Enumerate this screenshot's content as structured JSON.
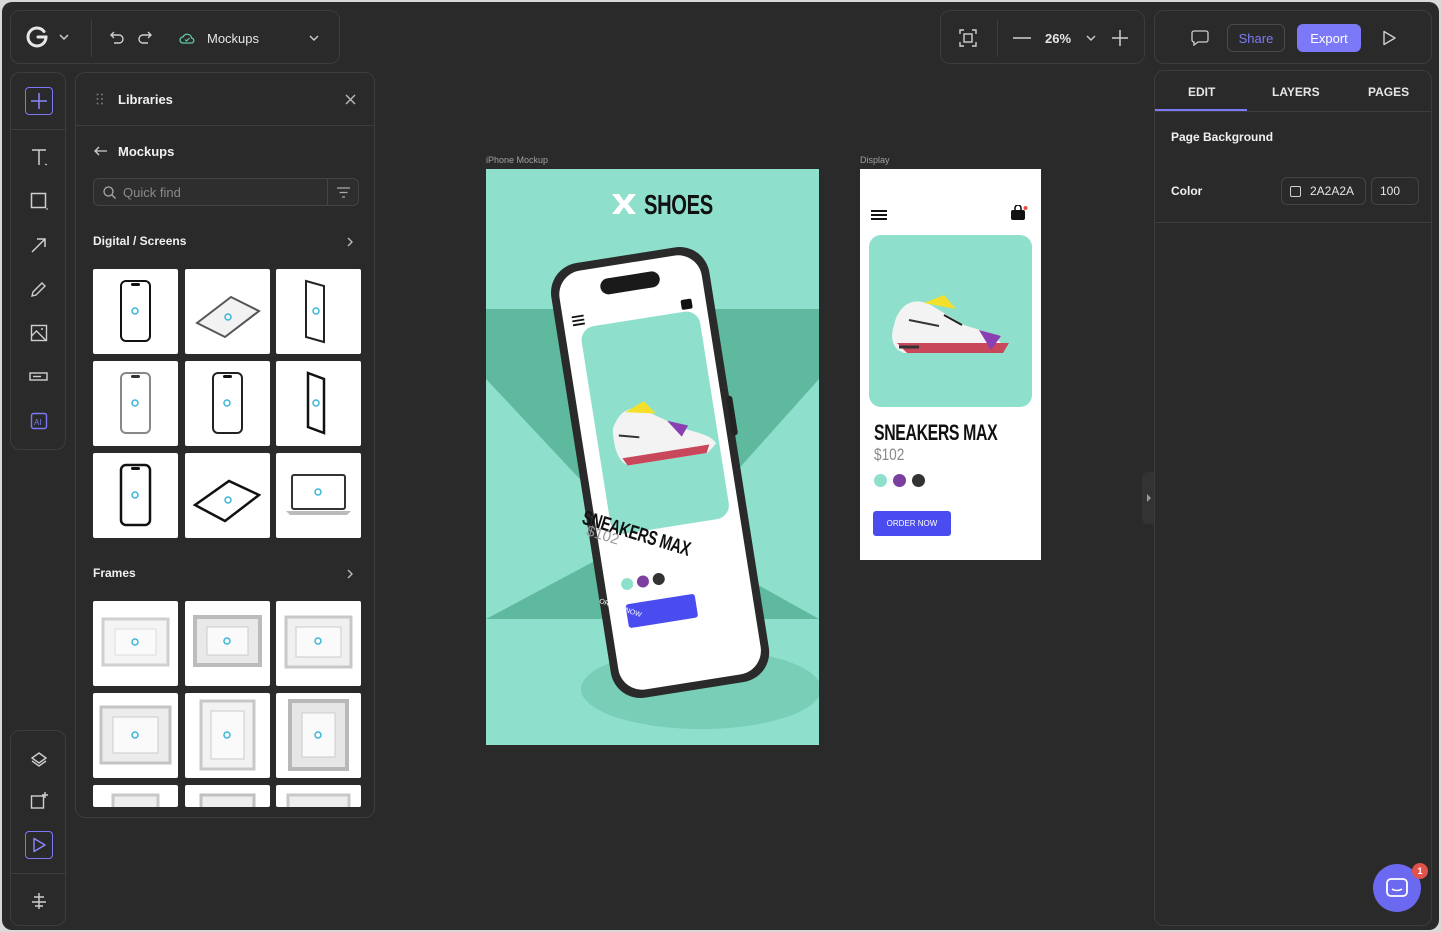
{
  "topbar": {
    "project_name": "Mockups",
    "zoom_level": "26%",
    "share_label": "Share",
    "export_label": "Export"
  },
  "toolbar": {
    "tools": [
      "add-icon",
      "text-icon",
      "rectangle-icon",
      "arrow-icon",
      "pen-icon",
      "image-icon",
      "input-icon",
      "ai-icon"
    ],
    "bottom_tools": [
      "layers-icon",
      "add-frame-icon",
      "select-icon",
      "align-icon"
    ]
  },
  "libraries": {
    "title": "Libraries",
    "back_label": "Mockups",
    "search_placeholder": "Quick find",
    "sections": [
      {
        "title": "Digital / Screens"
      },
      {
        "title": "Frames"
      }
    ]
  },
  "canvas": {
    "artboards": [
      {
        "label": "iPhone Mockup",
        "brand": "SHOES",
        "product_name": "SNEAKERS MAX",
        "price": "$102",
        "cta": "ORDER NOW"
      },
      {
        "label": "Display",
        "product_name": "SNEAKERS MAX",
        "price": "$102",
        "cta": "ORDER NOW"
      }
    ],
    "swatch_colors": [
      "#8ee0cd",
      "#7b3fa0",
      "#333333"
    ],
    "accent_color": "#4a4cf0",
    "mint_color": "#8ee0cd"
  },
  "props": {
    "tabs": [
      "EDIT",
      "LAYERS",
      "PAGES"
    ],
    "active_tab": "EDIT",
    "section_title": "Page Background",
    "color_label": "Color",
    "color_value": "2A2A2A",
    "opacity_value": "100"
  },
  "chat": {
    "badge_count": "1"
  }
}
